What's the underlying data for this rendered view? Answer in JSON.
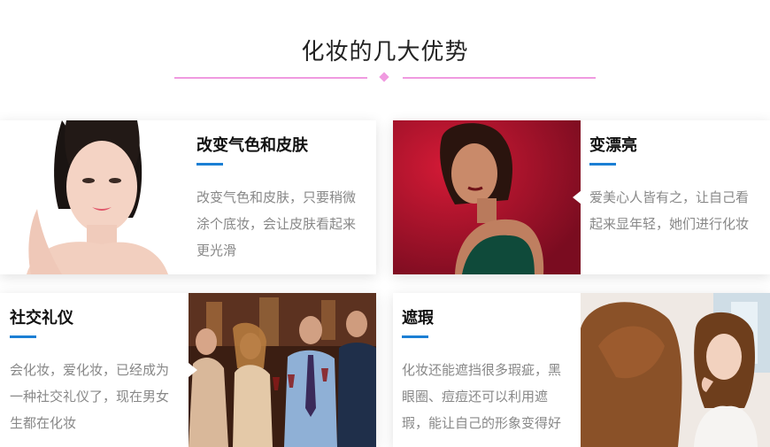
{
  "section": {
    "title": "化妆的几大优势"
  },
  "cards": [
    {
      "title": "改变气色和皮肤",
      "desc": "改变气色和皮肤，只要稍微涂个底妆，会让皮肤看起来更光滑",
      "image_alt": "woman-face-portrait"
    },
    {
      "title": "变漂亮",
      "desc": "爱美心人皆有之，让自己看起来显年轻，她们进行化妆",
      "image_alt": "woman-red-background-portrait"
    },
    {
      "title": "社交礼仪",
      "desc": "会化妆，爱化妆，已经成为一种社交礼仪了，现在男女生都在化妆",
      "image_alt": "people-toasting-wine"
    },
    {
      "title": "遮瑕",
      "desc": "化妆还能遮挡很多瑕疵，黑眼圈、痘痘还可以利用遮瑕，能让自己的形象变得好",
      "image_alt": "woman-applying-makeup-mirror"
    }
  ],
  "colors": {
    "accent_blue": "#1b7fd4",
    "divider_pink": "#f09ae0"
  }
}
